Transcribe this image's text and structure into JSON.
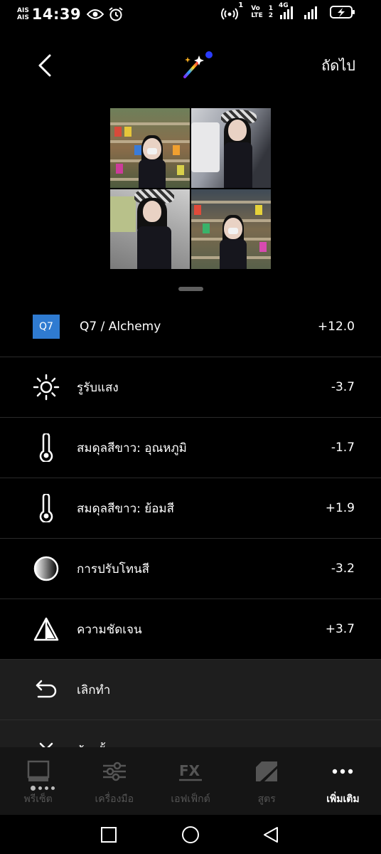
{
  "status": {
    "carrier_top": "AIS",
    "carrier_bottom": "AIS",
    "time": "14:39",
    "hotspot_sup": "1",
    "volte_top": "Vo",
    "volte_bottom": "LTE",
    "sim_top": "1",
    "sim_bottom": "2",
    "network": "4G"
  },
  "top_bar": {
    "next_label": "ถัดไป"
  },
  "adjustments": [
    {
      "icon": "q7-badge",
      "badge": "Q7",
      "label": "Q7 / Alchemy",
      "value": "+12.0"
    },
    {
      "icon": "exposure-icon",
      "label": "รูรับแสง",
      "value": "-3.7"
    },
    {
      "icon": "thermometer-icon",
      "label": "สมดุลสีขาว: อุณหภูมิ",
      "value": "-1.7"
    },
    {
      "icon": "thermometer-icon",
      "label": "สมดุลสีขาว: ย้อมสี",
      "value": "+1.9"
    },
    {
      "icon": "tone-icon",
      "label": "การปรับโทนสี",
      "value": "-3.2"
    },
    {
      "icon": "sharpen-icon",
      "label": "ความชัดเจน",
      "value": "+3.7"
    }
  ],
  "actions": {
    "undo_label": "เลิกทำ",
    "clear_label": "ล้างทั้งหมด"
  },
  "bottom_nav": [
    {
      "label": "พรีเซ็ต",
      "active": false
    },
    {
      "label": "เครื่องมือ",
      "active": false
    },
    {
      "label": "เอฟเฟ็กต์",
      "active": false
    },
    {
      "label": "สูตร",
      "active": false
    },
    {
      "label": "เพิ่มเติม",
      "active": true
    }
  ],
  "colors": {
    "background": "#000000",
    "badge": "#2f7bd1",
    "panel": "#1e1e1e",
    "nav_bg": "#151515",
    "inactive_text": "#555555",
    "magic_dot": "#2a3cff"
  }
}
